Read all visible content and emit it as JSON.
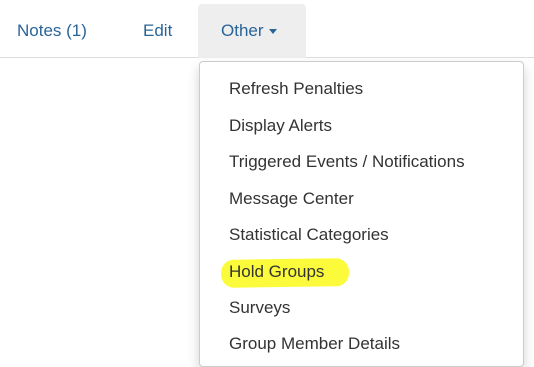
{
  "tabs": {
    "notes_label": "Notes (1)",
    "edit_label": "Edit",
    "other_label": "Other"
  },
  "menu": {
    "items": [
      {
        "label": "Refresh Penalties"
      },
      {
        "label": "Display Alerts"
      },
      {
        "label": "Triggered Events / Notifications"
      },
      {
        "label": "Message Center"
      },
      {
        "label": "Statistical Categories"
      },
      {
        "label": "Hold Groups",
        "highlighted": true
      },
      {
        "label": "Surveys"
      },
      {
        "label": "Group Member Details"
      }
    ]
  },
  "colors": {
    "link": "#2a6496",
    "active_tab_bg": "#eeeeee",
    "menu_text": "#333333",
    "highlight": "#fbfb3c"
  }
}
